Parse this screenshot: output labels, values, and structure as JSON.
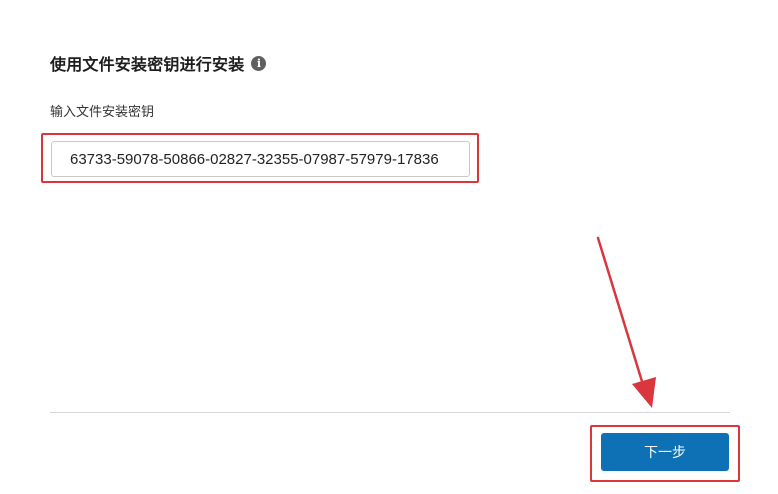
{
  "stepper": {
    "steps": [
      {
        "state": "active"
      },
      {
        "state": "inactive"
      },
      {
        "state": "inactive"
      },
      {
        "state": "inactive"
      },
      {
        "state": "inactive"
      }
    ]
  },
  "section": {
    "title": "使用文件安装密钥进行安装",
    "info_icon": "info-icon"
  },
  "key_field": {
    "label": "输入文件安装密钥",
    "value": "63733-59078-50866-02827-32355-07987-57979-17836"
  },
  "footer": {
    "next_label": "下一步"
  },
  "annotations": {
    "highlight_color": "#d9363e"
  },
  "colors": {
    "primary_button": "#0e71b5",
    "active_step": "#1f6fa8"
  }
}
